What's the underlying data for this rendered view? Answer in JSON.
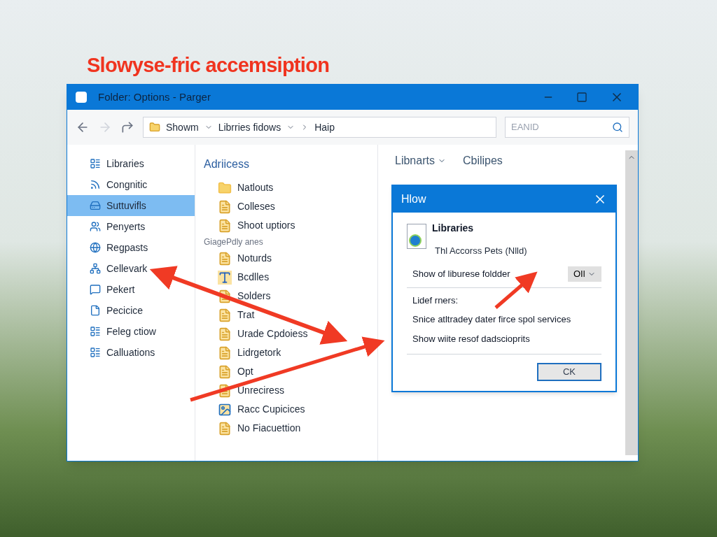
{
  "headline": "Slowyse-fric accemsiption",
  "window": {
    "title": "Folder: Options - Parger"
  },
  "toolbar": {
    "breadcrumbs": [
      {
        "label": "Showm",
        "kind": "folder"
      },
      {
        "label": "Librries fidows",
        "kind": "menu"
      },
      {
        "label": "Haip",
        "kind": "plain"
      }
    ],
    "search": {
      "placeholder": "EANID"
    }
  },
  "sidebar": {
    "items": [
      {
        "label": "Libraries",
        "selected": false,
        "kind": "library"
      },
      {
        "label": "Congnitic",
        "selected": false,
        "kind": "feed"
      },
      {
        "label": "Suttuvifls",
        "selected": true,
        "kind": "drive"
      },
      {
        "label": "Penyerts",
        "selected": false,
        "kind": "people"
      },
      {
        "label": "Regpasts",
        "selected": false,
        "kind": "globe"
      },
      {
        "label": "Cellevark",
        "selected": false,
        "kind": "network"
      },
      {
        "label": "Pekert",
        "selected": false,
        "kind": "chat"
      },
      {
        "label": "Pecicice",
        "selected": false,
        "kind": "page"
      },
      {
        "label": "Feleg ctiow",
        "selected": false,
        "kind": "library"
      },
      {
        "label": "Calluations",
        "selected": false,
        "kind": "library"
      }
    ]
  },
  "files": {
    "heading": "Adriicess",
    "items": [
      {
        "label": "Natlouts",
        "kind": "folder"
      },
      {
        "label": "Colleses",
        "kind": "document"
      },
      {
        "label": "Shoot uptiors",
        "kind": "document"
      },
      {
        "label": "GiagePdly anes",
        "kind": "group"
      },
      {
        "label": "Noturds",
        "kind": "document"
      },
      {
        "label": "Bcdlles",
        "kind": "font"
      },
      {
        "label": "Solders",
        "kind": "document"
      },
      {
        "label": "Trat",
        "kind": "document"
      },
      {
        "label": "Urade Cpdoiess",
        "kind": "document"
      },
      {
        "label": "Lidrgetork",
        "kind": "document"
      },
      {
        "label": "Opt",
        "kind": "document"
      },
      {
        "label": "Unreciress",
        "kind": "document"
      },
      {
        "label": "Racc Cupicices",
        "kind": "image"
      },
      {
        "label": "No Fiacuettion",
        "kind": "document"
      }
    ]
  },
  "pane_tabs": [
    {
      "label": "Libnarts",
      "kind": "menu"
    },
    {
      "label": "Cbilipes",
      "kind": "plain"
    }
  ],
  "dialog": {
    "title": "Hlow",
    "heading": "Libraries",
    "subtitle": "Thl Accorss Pets (Nlld)",
    "setting": {
      "label": "Show of liburese foldder",
      "value": "OIl"
    },
    "section_label": "Lidef rners:",
    "lines": [
      "Snice atltradey dater firce spol services",
      "Show wiite resof dadscioprits"
    ],
    "button": "CK"
  }
}
